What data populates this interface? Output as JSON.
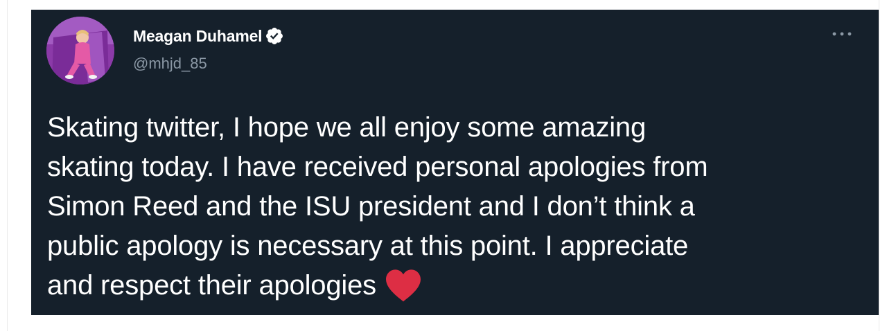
{
  "tweet": {
    "author_name": "Meagan Duhamel",
    "author_handle": "@mhjd_85",
    "verified_icon": "verified-badge-icon",
    "more_icon": "more-options-icon",
    "text_lines": [
      "Skating twitter, I hope we all enjoy some amazing",
      "skating today. I have received personal apologies from",
      "Simon Reed and the ISU president and I don’t think a",
      "public apology is necessary at this point. I appreciate",
      "and respect their apologies"
    ],
    "emoji": "red-heart-icon"
  },
  "colors": {
    "card_background": "#15202b",
    "text_primary": "#ffffff",
    "text_secondary": "#8b98a5",
    "heart": "#dd2e44"
  }
}
